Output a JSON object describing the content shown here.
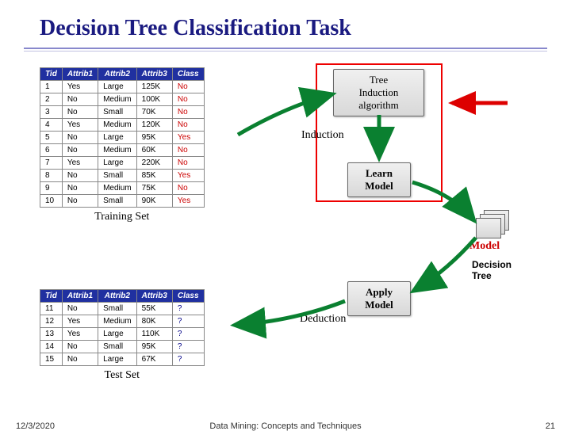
{
  "title": "Decision Tree Classification Task",
  "boxes": {
    "induction_algo": "Tree\nInduction\nalgorithm",
    "learn": "Learn\nModel",
    "apply": "Apply\nModel",
    "model": "Model"
  },
  "labels": {
    "induction": "Induction",
    "deduction": "Deduction",
    "training": "Training Set",
    "test": "Test Set",
    "decision_tree": "Decision\nTree"
  },
  "train": {
    "headers": [
      "Tid",
      "Attrib1",
      "Attrib2",
      "Attrib3",
      "Class"
    ],
    "rows": [
      [
        "1",
        "Yes",
        "Large",
        "125K",
        "No"
      ],
      [
        "2",
        "No",
        "Medium",
        "100K",
        "No"
      ],
      [
        "3",
        "No",
        "Small",
        "70K",
        "No"
      ],
      [
        "4",
        "Yes",
        "Medium",
        "120K",
        "No"
      ],
      [
        "5",
        "No",
        "Large",
        "95K",
        "Yes"
      ],
      [
        "6",
        "No",
        "Medium",
        "60K",
        "No"
      ],
      [
        "7",
        "Yes",
        "Large",
        "220K",
        "No"
      ],
      [
        "8",
        "No",
        "Small",
        "85K",
        "Yes"
      ],
      [
        "9",
        "No",
        "Medium",
        "75K",
        "No"
      ],
      [
        "10",
        "No",
        "Small",
        "90K",
        "Yes"
      ]
    ]
  },
  "test": {
    "headers": [
      "Tid",
      "Attrib1",
      "Attrib2",
      "Attrib3",
      "Class"
    ],
    "rows": [
      [
        "11",
        "No",
        "Small",
        "55K",
        "?"
      ],
      [
        "12",
        "Yes",
        "Medium",
        "80K",
        "?"
      ],
      [
        "13",
        "Yes",
        "Large",
        "110K",
        "?"
      ],
      [
        "14",
        "No",
        "Small",
        "95K",
        "?"
      ],
      [
        "15",
        "No",
        "Large",
        "67K",
        "?"
      ]
    ]
  },
  "footer": {
    "date": "12/3/2020",
    "mid": "Data Mining: Concepts and Techniques",
    "page": "21"
  }
}
